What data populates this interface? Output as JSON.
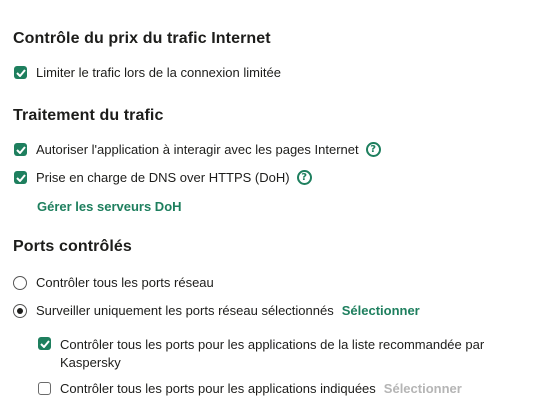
{
  "sections": {
    "traffic_price": {
      "title": "Contrôle du prix du trafic Internet",
      "limit_metered": {
        "label": "Limiter le trafic lors de la connexion limitée",
        "checked": true
      }
    },
    "traffic_processing": {
      "title": "Traitement du trafic",
      "allow_web_interaction": {
        "label": "Autoriser l'application à interagir avec les pages Internet",
        "checked": true
      },
      "doh_support": {
        "label": "Prise en charge de DNS over HTTPS (DoH)",
        "checked": true
      },
      "manage_doh_link": "Gérer les serveurs DoH"
    },
    "monitored_ports": {
      "title": "Ports contrôlés",
      "all_ports": {
        "label": "Contrôler tous les ports réseau",
        "selected": false
      },
      "selected_ports": {
        "label": "Surveiller uniquement les ports réseau sélectionnés",
        "selected": true,
        "link": "Sélectionner"
      },
      "recommended_apps": {
        "label_line1": "Contrôler tous les ports pour les applications de la liste recommandée par",
        "label_line2": "Kaspersky",
        "checked": true
      },
      "specified_apps": {
        "label": "Contrôler tous les ports pour les applications indiquées",
        "checked": false,
        "link": "Sélectionner"
      }
    }
  },
  "icons": {
    "checkbox": "checkmark-icon",
    "help": "question-circle-icon"
  },
  "colors": {
    "accent": "#1e7f5e",
    "text": "#1d1d1b",
    "disabled": "#b5b5b5"
  }
}
